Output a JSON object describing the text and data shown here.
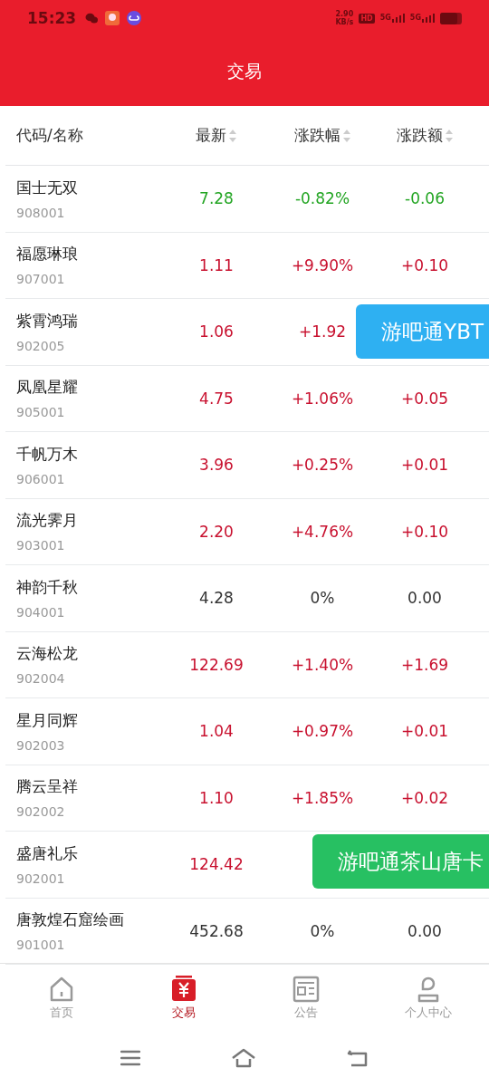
{
  "status_bar": {
    "time": "15:23",
    "speed": "2.90",
    "speed_unit": "KB/s",
    "hd": "HD",
    "signal_1": "5G",
    "signal_2": "5G"
  },
  "header": {
    "title": "交易"
  },
  "table": {
    "columns": [
      {
        "label": "代码/名称",
        "sortable": false
      },
      {
        "label": "最新",
        "sortable": true
      },
      {
        "label": "涨跌幅",
        "sortable": true
      },
      {
        "label": "涨跌额",
        "sortable": true
      }
    ],
    "rows": [
      {
        "name": "国士无双",
        "code": "908001",
        "price": "7.28",
        "change": "-0.82%",
        "amount": "-0.06",
        "kind": "down"
      },
      {
        "name": "福愿琳琅",
        "code": "907001",
        "price": "1.11",
        "change": "+9.90%",
        "amount": "+0.10",
        "kind": "up"
      },
      {
        "name": "紫霄鸿瑞",
        "code": "902005",
        "price": "1.06",
        "change": "+1.92",
        "kind": "up"
      },
      {
        "name": "凤凰星耀",
        "code": "905001",
        "price": "4.75",
        "change": "+1.06%",
        "amount": "+0.05",
        "kind": "up"
      },
      {
        "name": "千帆万木",
        "code": "906001",
        "price": "3.96",
        "change": "+0.25%",
        "amount": "+0.01",
        "kind": "up"
      },
      {
        "name": "流光霁月",
        "code": "903001",
        "price": "2.20",
        "change": "+4.76%",
        "amount": "+0.10",
        "kind": "up"
      },
      {
        "name": "神韵千秋",
        "code": "904001",
        "price": "4.28",
        "change": "0%",
        "amount": "0.00",
        "kind": "flat"
      },
      {
        "name": "云海松龙",
        "code": "902004",
        "price": "122.69",
        "change": "+1.40%",
        "amount": "+1.69",
        "kind": "up"
      },
      {
        "name": "星月同辉",
        "code": "902003",
        "price": "1.04",
        "change": "+0.97%",
        "amount": "+0.01",
        "kind": "up"
      },
      {
        "name": "腾云呈祥",
        "code": "902002",
        "price": "1.10",
        "change": "+1.85%",
        "amount": "+0.02",
        "kind": "up"
      },
      {
        "name": "盛唐礼乐",
        "code": "902001",
        "price": "124.42",
        "kind": "up"
      },
      {
        "name": "唐敦煌石窟绘画",
        "code": "901001",
        "price": "452.68",
        "change": "0%",
        "amount": "0.00",
        "kind": "flat"
      }
    ]
  },
  "floating_buttons": [
    {
      "label": "游吧通YBT",
      "color": "#2eb0f2"
    },
    {
      "label": "游吧通茶山唐卡",
      "color": "#27c062"
    }
  ],
  "bottom_nav": [
    {
      "label": "首页",
      "kind": "home",
      "selected": false
    },
    {
      "label": "交易",
      "kind": "yuan",
      "selected": true
    },
    {
      "label": "公告",
      "kind": "news",
      "selected": false
    },
    {
      "label": "个人中心",
      "kind": "person",
      "selected": false
    }
  ]
}
